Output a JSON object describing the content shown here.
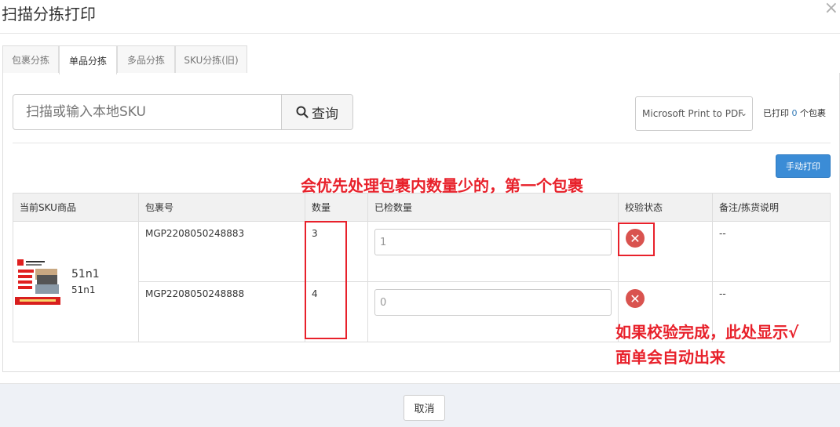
{
  "header": {
    "title": "扫描分拣打印",
    "close": "×"
  },
  "tabs": [
    {
      "label": "包裹分拣",
      "active": false
    },
    {
      "label": "单品分拣",
      "active": true
    },
    {
      "label": "多品分拣",
      "active": false
    },
    {
      "label": "SKU分拣(旧)",
      "active": false
    }
  ],
  "search": {
    "placeholder": "扫描或输入本地SKU",
    "button_label": "查询",
    "button_icon": "search-icon"
  },
  "printer": {
    "selected": "Microsoft Print to PDF"
  },
  "printed_status": {
    "prefix": "已打印",
    "count": "0",
    "suffix": "个包裹"
  },
  "manual_print_label": "手动打印",
  "annotations": {
    "top": "会优先处理包裹内数量少的，第一个包裹",
    "bottom_line1": "如果校验完成，此处显示√",
    "bottom_line2": "面单会自动出来"
  },
  "table": {
    "headers": [
      "当前SKU商品",
      "包裹号",
      "数量",
      "已检数量",
      "校验状态",
      "备注/拣货说明"
    ],
    "product": {
      "name": "51n1",
      "sub": "51n1"
    },
    "rows": [
      {
        "package_no": "MGP2208050248883",
        "qty": "3",
        "checked": "1",
        "status_icon": "error-x-icon",
        "remark": "--"
      },
      {
        "package_no": "MGP2208050248888",
        "qty": "4",
        "checked": "0",
        "status_icon": "error-x-icon",
        "remark": "--"
      }
    ]
  },
  "footer": {
    "cancel_label": "取消"
  },
  "colors": {
    "accent": "#3b8cd6",
    "annotation": "#e8212b",
    "error": "#d9534f"
  }
}
